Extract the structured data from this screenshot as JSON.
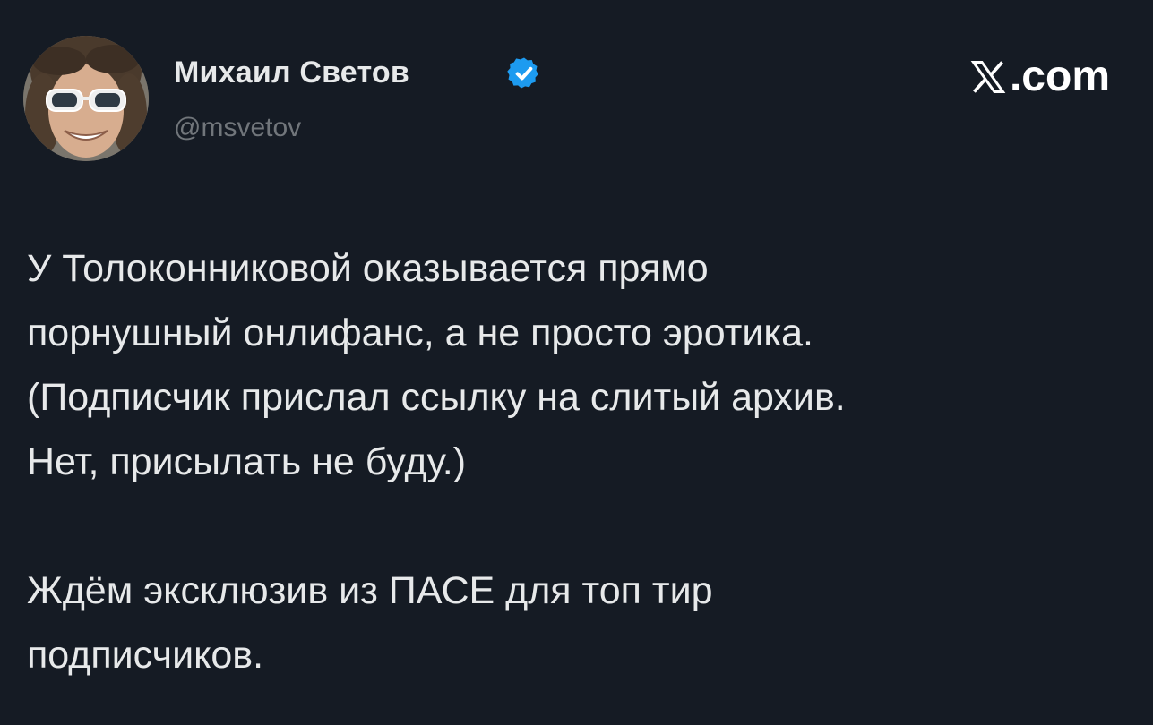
{
  "author": {
    "name": "Михаил Светов",
    "handle": "@msvetov",
    "verified": true
  },
  "brand": {
    "suffix": ".com"
  },
  "tweet": {
    "paragraph1": [
      "У Толоконниковой оказывается прямо",
      "порнушный онлифанс, а не просто эротика.",
      "(Подписчик прислал ссылку на слитый архив.",
      "Нет, присылать не буду.)"
    ],
    "paragraph2": [
      "Ждём эксклюзив из ПАСЕ для топ тир",
      "подписчиков."
    ]
  },
  "colors": {
    "background": "#151b24",
    "text": "#e7e9ea",
    "secondary_text": "#71767b",
    "verified_badge": "#1d9bf0"
  },
  "icons": {
    "verified": "verified-badge-icon",
    "brand": "x-logo-icon"
  }
}
